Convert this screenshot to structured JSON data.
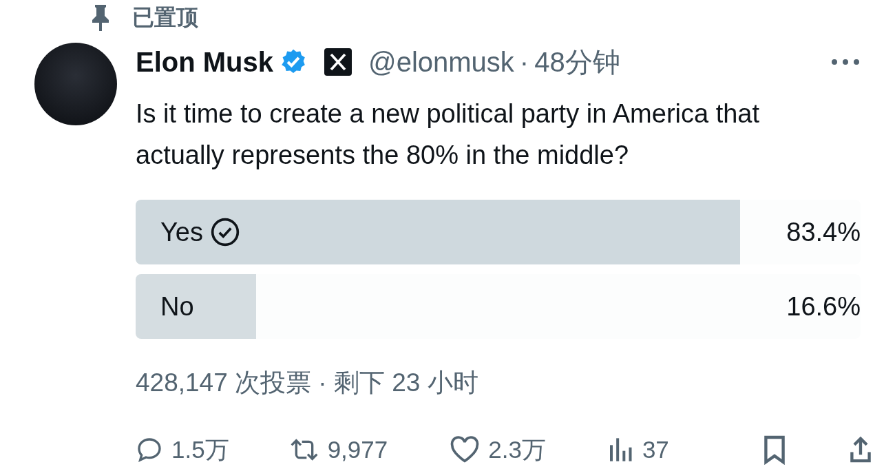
{
  "pinned": {
    "label": "已置顶"
  },
  "author": {
    "name": "Elon Musk",
    "verified": true,
    "handle": "@elonmusk",
    "separator": "·",
    "time": "48分钟"
  },
  "text": "Is it time to create a new political party in America that actually represents the 80% in the middle?",
  "poll": {
    "options": [
      {
        "label": "Yes",
        "percent": "83.4%",
        "level": 0.834,
        "selected": true
      },
      {
        "label": "No",
        "percent": "16.6%",
        "level": 0.166,
        "selected": false
      }
    ],
    "summary": "428,147 次投票 · 剩下 23 小时"
  },
  "stats": [
    {
      "kind": "reply",
      "count": "1.5万"
    },
    {
      "kind": "repost",
      "count": "9,977"
    },
    {
      "kind": "like",
      "count": "2.3万"
    },
    {
      "kind": "views",
      "count": "37"
    },
    {
      "kind": "bookmark"
    },
    {
      "kind": "share"
    }
  ]
}
